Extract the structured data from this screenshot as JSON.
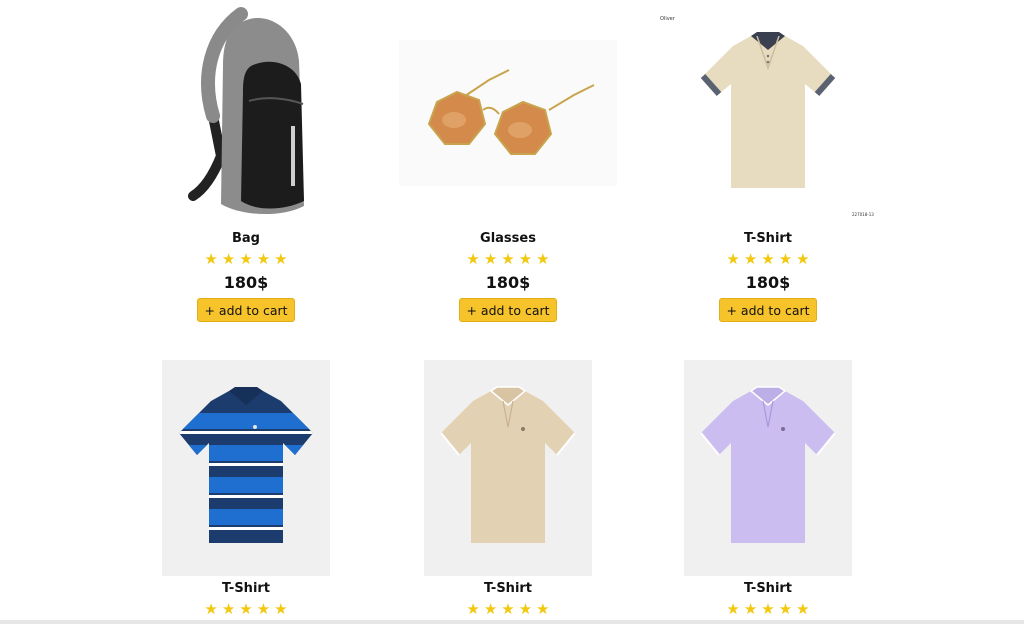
{
  "products": [
    {
      "name": "Bag",
      "price": "180$",
      "cart_label": "+ add to cart",
      "rating": 5,
      "icon": "sling-bag-icon"
    },
    {
      "name": "Glasses",
      "price": "180$",
      "cart_label": "+ add to cart",
      "rating": 5,
      "icon": "sunglasses-icon"
    },
    {
      "name": "T-Shirt",
      "price": "180$",
      "cart_label": "+ add to cart",
      "rating": 5,
      "icon": "polo-shirt-icon"
    },
    {
      "name": "T-Shirt",
      "rating": 5,
      "icon": "striped-polo-icon"
    },
    {
      "name": "T-Shirt",
      "rating": 5,
      "icon": "beige-polo-icon"
    },
    {
      "name": "T-Shirt",
      "rating": 5,
      "icon": "lavender-polo-icon"
    }
  ],
  "photo_texts": {
    "logo": "Oliver",
    "code": "227018-13"
  },
  "colors": {
    "star": "#f2c811",
    "button": "#f6c32a"
  }
}
